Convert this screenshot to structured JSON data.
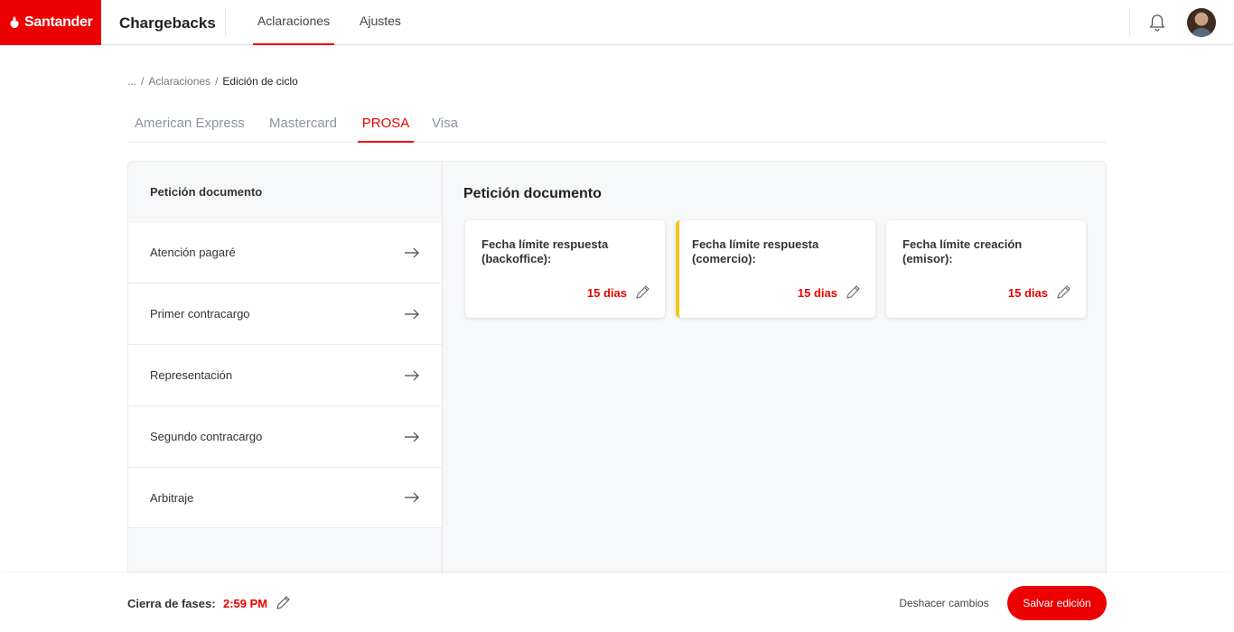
{
  "brand": {
    "name": "Santander",
    "color": "#ec0000"
  },
  "header": {
    "app_title": "Chargebacks",
    "nav": [
      {
        "label": "Aclaraciones",
        "active": true
      },
      {
        "label": "Ajustes",
        "active": false
      }
    ],
    "icons": [
      "bell-icon",
      "avatar"
    ]
  },
  "breadcrumb": {
    "ellipsis": "...",
    "separator": "/",
    "parent": "Aclaraciones",
    "current": "Edición de ciclo"
  },
  "tabs": [
    {
      "label": "American Express",
      "active": false
    },
    {
      "label": "Mastercard",
      "active": false
    },
    {
      "label": "PROSA",
      "active": true
    },
    {
      "label": "Visa",
      "active": false
    }
  ],
  "phases": {
    "header": "Petición documento",
    "items": [
      {
        "label": "Atención pagaré"
      },
      {
        "label": "Primer contracargo"
      },
      {
        "label": "Representación"
      },
      {
        "label": "Segundo contracargo"
      },
      {
        "label": "Arbitraje"
      }
    ]
  },
  "detail": {
    "title": "Petición documento",
    "cards": [
      {
        "label": "Fecha límite respuesta (backoffice):",
        "value": "15 dias",
        "highlighted": false
      },
      {
        "label": "Fecha límite respuesta (comercio):",
        "value": "15 dias",
        "highlighted": true,
        "highlight_color": "#f5c518"
      },
      {
        "label": "Fecha límite creación (emisor):",
        "value": "15 dias",
        "highlighted": false
      }
    ]
  },
  "footer": {
    "label": "Cierra de fases:",
    "time": "2:59 PM",
    "undo_label": "Deshacer cambios",
    "save_label": "Salvar edición"
  }
}
